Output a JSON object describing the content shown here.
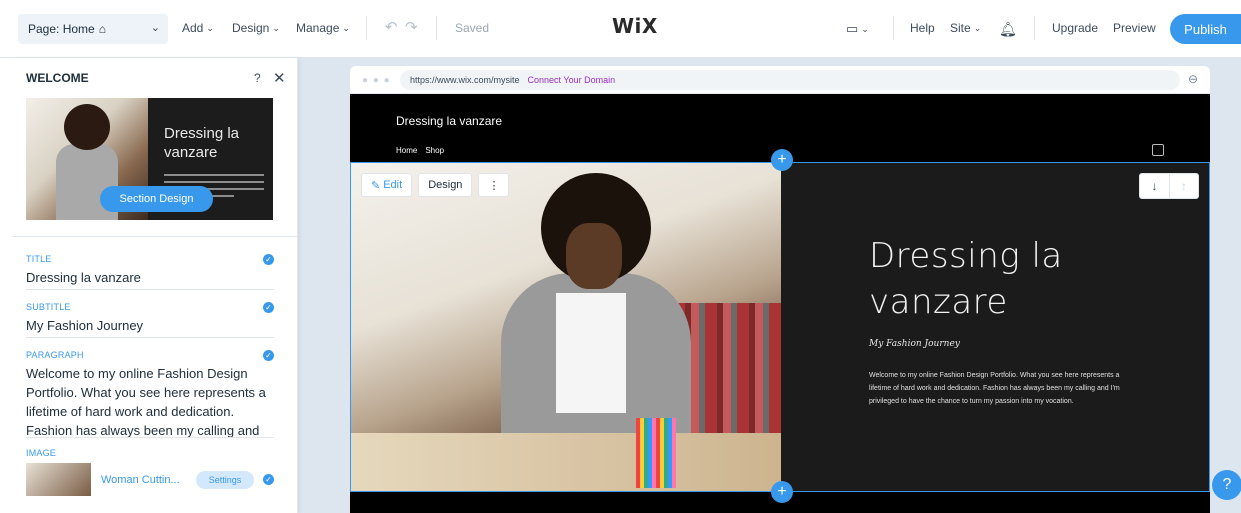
{
  "topbar": {
    "page_label": "Page: Home",
    "page_icon": "home-icon",
    "add_label": "Add",
    "design_label": "Design",
    "manage_label": "Manage",
    "saved_label": "Saved",
    "logo_text": "WiX",
    "help_label": "Help",
    "site_label": "Site",
    "upgrade_label": "Upgrade",
    "preview_label": "Preview",
    "publish_label": "Publish",
    "accent_color": "#3899ec"
  },
  "panel": {
    "title": "WELCOME",
    "help_glyph": "?",
    "close_glyph": "✕",
    "thumbnail_title": "Dressing la vanzare",
    "section_design_label": "Section Design",
    "fields": [
      {
        "label": "TITLE",
        "value": "Dressing la vanzare"
      },
      {
        "label": "SUBTITLE",
        "value": "My Fashion Journey"
      },
      {
        "label": "PARAGRAPH",
        "value": "Welcome to my online Fashion Design Portfolio. What you see here represents a lifetime of hard work and dedication. Fashion has always been my calling and"
      }
    ],
    "image_label": "IMAGE",
    "image_name": "Woman Cuttin...",
    "image_settings_label": "Settings"
  },
  "browser": {
    "url": "https://www.wix.com/mysite",
    "connect_domain": "Connect Your Domain"
  },
  "site": {
    "name": "Dressing la vanzare",
    "nav": [
      "Home",
      "Shop"
    ],
    "hero_title": "Dressing la vanzare",
    "hero_subtitle": "My Fashion Journey",
    "hero_paragraph": "Welcome to my online Fashion Design Portfolio. What you see here represents a lifetime of hard work and dedication. Fashion has always been my calling and I'm privileged to have the chance to turn my passion into my vocation.",
    "edit_label": "Edit",
    "design_label": "Design",
    "more_glyph": "⋮",
    "down_glyph": "↓",
    "up_glyph": "↑"
  }
}
